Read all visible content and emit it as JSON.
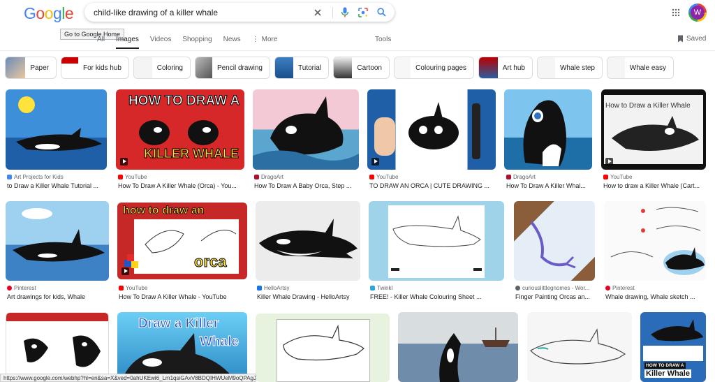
{
  "logo": {
    "letters": [
      "G",
      "o",
      "o",
      "g",
      "l",
      "e"
    ],
    "colors": [
      "#4285f4",
      "#ea4335",
      "#fbbc05",
      "#4285f4",
      "#34a853",
      "#ea4335"
    ]
  },
  "tooltip": "Go to Google Home",
  "search": {
    "query": "child-like drawing of a killer whale"
  },
  "avatar": {
    "letter": "W"
  },
  "tabs": [
    "All",
    "Images",
    "Videos",
    "Shopping",
    "News",
    "More"
  ],
  "tools": "Tools",
  "saved": "Saved",
  "chips": [
    "Paper",
    "For kids hub",
    "Coloring",
    "Pencil drawing",
    "Tutorial",
    "Cartoon",
    "Colouring pages",
    "Art hub",
    "Whale step",
    "Whale easy"
  ],
  "results": [
    {
      "source": "Art Projects for Kids",
      "fav": "#4285f4",
      "caption": "to Draw a Killer Whale Tutorial ..."
    },
    {
      "source": "YouTube",
      "fav": "#ff0000",
      "caption": "How To Draw A Killer Whale (Orca) - You..."
    },
    {
      "source": "DragoArt",
      "fav": "#b0102f",
      "caption": "How To Draw A Baby Orca, Step ..."
    },
    {
      "source": "YouTube",
      "fav": "#ff0000",
      "caption": "TO DRAW AN ORCA | CUTE DRAWING ..."
    },
    {
      "source": "DragoArt",
      "fav": "#b0102f",
      "caption": "How To Draw A Killer Whal..."
    },
    {
      "source": "YouTube",
      "fav": "#ff0000",
      "caption": "How to draw a Killer Whale (Cart..."
    },
    {
      "source": "Pinterest",
      "fav": "#e60023",
      "caption": "Art drawings for kids, Whale"
    },
    {
      "source": "YouTube",
      "fav": "#ff0000",
      "caption": "How To Draw A Killer Whale - YouTube"
    },
    {
      "source": "HelloArtsy",
      "fav": "#1a73e8",
      "caption": "Killer Whale Drawing - HelloArtsy"
    },
    {
      "source": "Twinkl",
      "fav": "#29a8e0",
      "caption": "FREE! - Killer Whale Colouring Sheet ..."
    },
    {
      "source": "curiouslittlegnomes - Wor...",
      "fav": "#5f6368",
      "caption": "Finger Painting Orcas an..."
    },
    {
      "source": "Pinterest",
      "fav": "#e60023",
      "caption": "Whale drawing, Whale sketch ..."
    }
  ],
  "thumb_text": {
    "t2": "HOW TO DRAW A",
    "t2b": "KILLER WHALE",
    "t6": "How to Draw a  Killer Whale",
    "t8": "how to draw an",
    "t8b": "orca",
    "t14": "Draw a Killer",
    "t14b": "Whale",
    "t18": "HOW TO DRAW A",
    "t18b": "Killer Whale"
  },
  "status_url": "https://www.google.com/webhp?hl=en&sa=X&ved=0ahUKEwi6_Lm1qsiGAxV8BDQIHWUeM9oQPAgJ"
}
